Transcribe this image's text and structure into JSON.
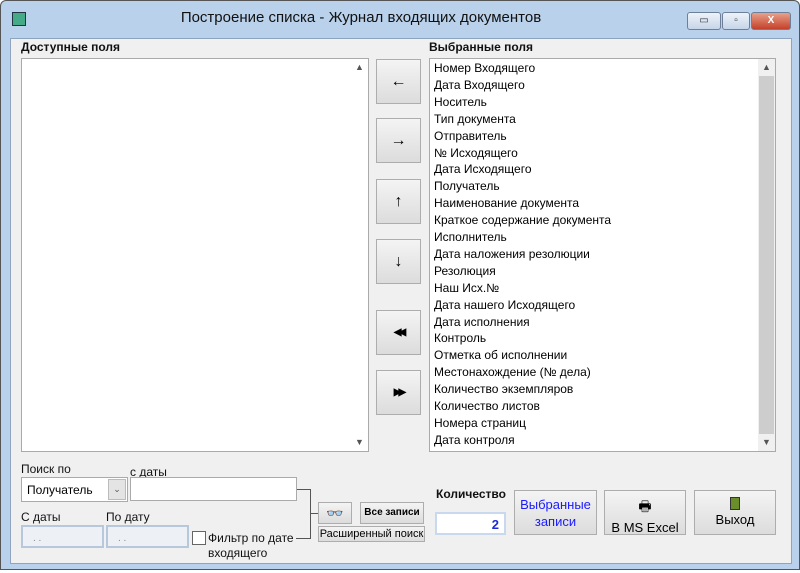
{
  "window": {
    "title": "Построение списка - Журнал входящих документов",
    "minimize": "▭",
    "maximize": "▫",
    "close": "X"
  },
  "available": {
    "label": "Доступные поля",
    "items": []
  },
  "selected": {
    "label": "Выбранные поля",
    "items": [
      "Номер Входящего",
      "Дата Входящего",
      "Носитель",
      "Тип документа",
      "Отправитель",
      "№ Исходящего",
      "Дата Исходящего",
      "Получатель",
      "Наименование документа",
      "Краткое содержание документа",
      "Исполнитель",
      "Дата наложения резолюции",
      "Резолюция",
      "Наш Исх.№",
      "Дата нашего Исходящего",
      "Дата исполнения",
      "Контроль",
      "Отметка об исполнении",
      "Местонахождение (№ дела)",
      "Количество экземпляров",
      "Количество листов",
      "Номера страниц",
      "Дата контроля"
    ]
  },
  "move": {
    "left": "←",
    "right": "→",
    "up": "↑",
    "down": "↓",
    "all_left": "◀◀",
    "all_right": "▶▶"
  },
  "search": {
    "label": "Поиск по",
    "field": "Получатель",
    "from_label": "с даты",
    "value": "",
    "date_from_label": "С даты",
    "date_from": ". .",
    "date_to_label": "По дату",
    "date_to": ". .",
    "filter_label": "Фильтр по дате входящего",
    "all_records": "Все записи",
    "advanced": "Расширенный поиск"
  },
  "count": {
    "label": "Количество",
    "value": "2"
  },
  "buttons": {
    "selected_records": "Выбранные записи",
    "excel": "В MS Excel",
    "exit": "Выход"
  }
}
